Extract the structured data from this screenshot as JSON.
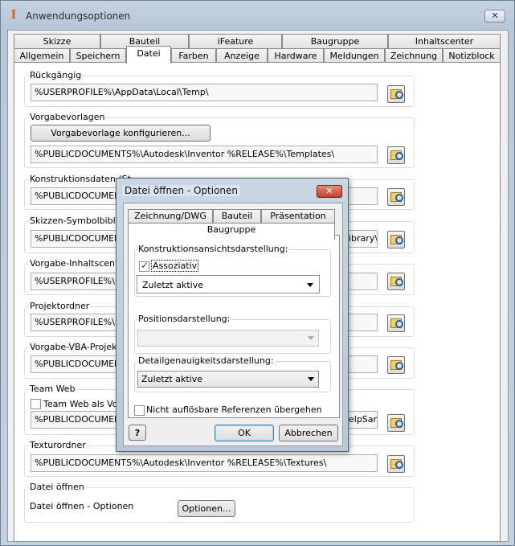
{
  "window": {
    "title": "Anwendungsoptionen",
    "close": "✕"
  },
  "tabs_row1": [
    "Skizze",
    "Bauteil",
    "iFeature",
    "Baugruppe",
    "Inhaltscenter"
  ],
  "tabs_row2": [
    "Allgemein",
    "Speichern",
    "Datei",
    "Farben",
    "Anzeige",
    "Hardware",
    "Meldungen",
    "Zeichnung",
    "Notizblock"
  ],
  "active_tab": "Datei",
  "groups": {
    "undo": {
      "label": "Rückgängig",
      "value": "%USERPROFILE%\\AppData\\Local\\Temp\\"
    },
    "templates": {
      "label": "Vorgabevorlagen",
      "button": "Vorgabevorlage konfigurieren...",
      "value": "%PUBLICDOCUMENTS%\\Autodesk\\Inventor %RELEASE%\\Templates\\"
    },
    "design_data": {
      "label": "Konstruktionsdaten (St",
      "label_tail": "...)",
      "value": "%PUBLICDOCUMENT"
    },
    "sketch_symbols": {
      "label": "Skizzen-Symbolbibliot",
      "value": "%PUBLICDOCUMENT",
      "value_tail": "ibrary\\"
    },
    "content_center": {
      "label": "Vorgabe-Inhaltscenter",
      "value": "%USERPROFILE%\\D"
    },
    "project": {
      "label": "Projektordner",
      "value": "%USERPROFILE%\\D"
    },
    "vba": {
      "label": "Vorgabe-VBA-Projekt",
      "value": "%PUBLICDOCUMENT"
    },
    "team_web": {
      "label": "Team Web",
      "checkbox": "Team Web als Vorg",
      "value": "%PUBLICDOCUMENT",
      "value_tail": "elpSam"
    },
    "textures": {
      "label": "Texturordner",
      "value": "%PUBLICDOCUMENTS%\\Autodesk\\Inventor %RELEASE%\\Textures\\"
    },
    "file_open": {
      "label": "Datei öffnen",
      "text": "Datei öffnen - Optionen",
      "button": "Optionen..."
    }
  },
  "dialog": {
    "title": "Datei öffnen - Optionen",
    "close": "✕",
    "tabs_row1": [
      "Zeichnung/DWG",
      "Bauteil",
      "Präsentation"
    ],
    "tab_active": "Baugruppe",
    "view_rep_label": "Konstruktionsansichtsdarstellung:",
    "associative_label": "Assoziativ",
    "associative_checked": true,
    "view_rep_value": "Zuletzt aktive",
    "position_label": "Positionsdarstellung:",
    "position_value": "",
    "lod_label": "Detailgenauigkeitsdarstellung:",
    "lod_value": "Zuletzt aktive",
    "skip_unresolved_label": "Nicht auflösbare Referenzen übergehen",
    "skip_unresolved_checked": false,
    "help": "?",
    "ok": "OK",
    "cancel": "Abbrechen"
  }
}
